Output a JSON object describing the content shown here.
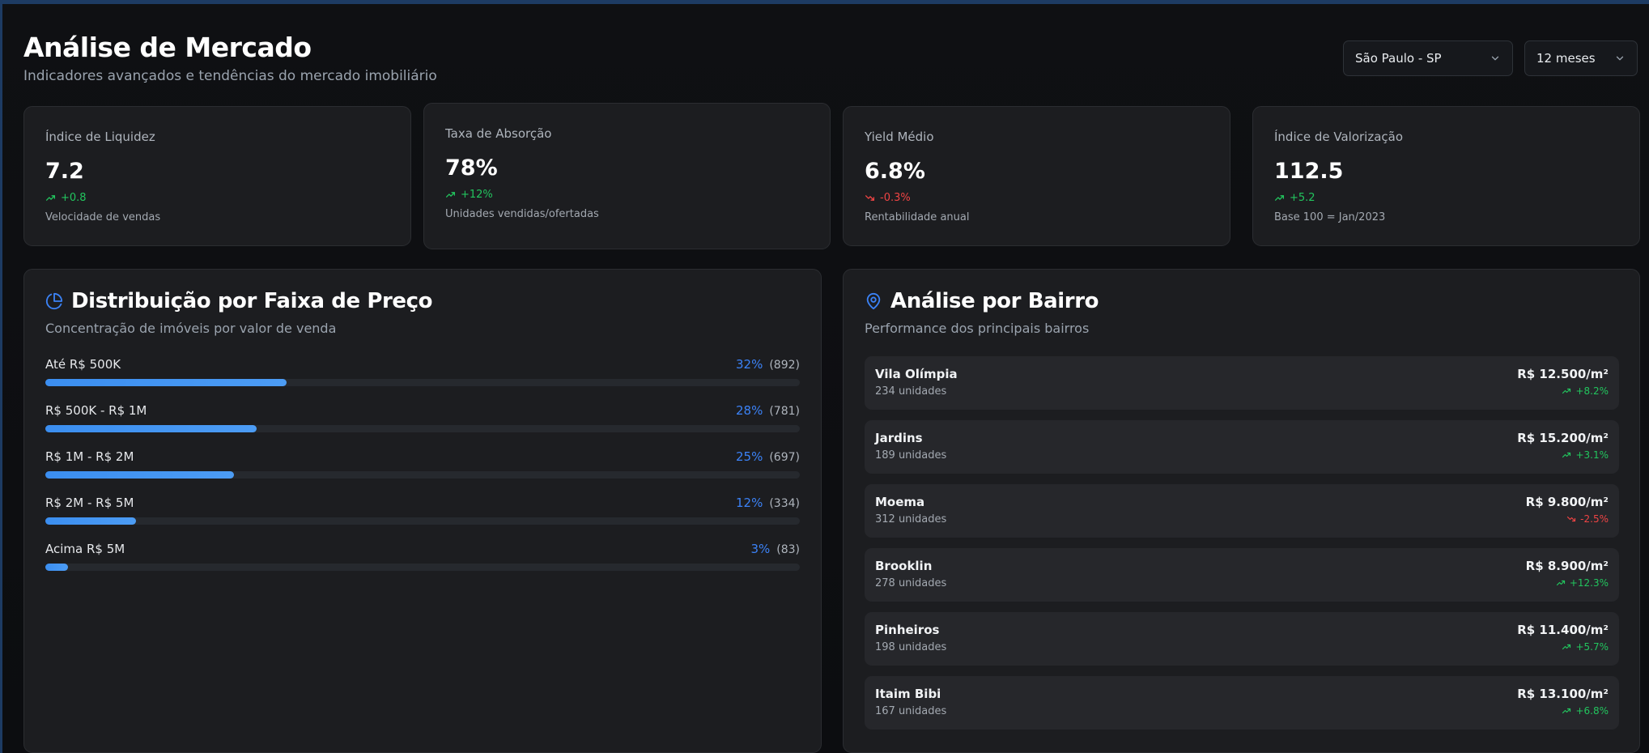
{
  "header": {
    "title": "Análise de Mercado",
    "subtitle": "Indicadores avançados e tendências do mercado imobiliário"
  },
  "controls": {
    "city": "São Paulo - SP",
    "period": "12 meses"
  },
  "kpis": [
    {
      "label": "Índice de Liquidez",
      "value": "7.2",
      "change": "+0.8",
      "trend": "up",
      "desc": "Velocidade de vendas"
    },
    {
      "label": "Taxa de Absorção",
      "value": "78%",
      "change": "+12%",
      "trend": "up",
      "desc": "Unidades vendidas/ofertadas"
    },
    {
      "label": "Yield Médio",
      "value": "6.8%",
      "change": "-0.3%",
      "trend": "down",
      "desc": "Rentabilidade anual"
    },
    {
      "label": "Índice de Valorização",
      "value": "112.5",
      "change": "+5.2",
      "trend": "up",
      "desc": "Base 100 = Jan/2023"
    }
  ],
  "distribution": {
    "title": "Distribuição por Faixa de Preço",
    "subtitle": "Concentração de imóveis por valor de venda",
    "ranges": [
      {
        "label": "Até R$ 500K",
        "pct": "32%",
        "count": "(892)",
        "share": 32
      },
      {
        "label": "R$ 500K - R$ 1M",
        "pct": "28%",
        "count": "(781)",
        "share": 28
      },
      {
        "label": "R$ 1M - R$ 2M",
        "pct": "25%",
        "count": "(697)",
        "share": 25
      },
      {
        "label": "R$ 2M - R$ 5M",
        "pct": "12%",
        "count": "(334)",
        "share": 12
      },
      {
        "label": "Acima R$ 5M",
        "pct": "3%",
        "count": "(83)",
        "share": 3
      }
    ]
  },
  "neighborhoods": {
    "title": "Análise por Bairro",
    "subtitle": "Performance dos principais bairros",
    "items": [
      {
        "name": "Vila Olímpia",
        "units": "234 unidades",
        "price": "R$ 12.500/m²",
        "change": "+8.2%",
        "trend": "up"
      },
      {
        "name": "Jardins",
        "units": "189 unidades",
        "price": "R$ 15.200/m²",
        "change": "+3.1%",
        "trend": "up"
      },
      {
        "name": "Moema",
        "units": "312 unidades",
        "price": "R$ 9.800/m²",
        "change": "-2.5%",
        "trend": "down"
      },
      {
        "name": "Brooklin",
        "units": "278 unidades",
        "price": "R$ 8.900/m²",
        "change": "+12.3%",
        "trend": "up"
      },
      {
        "name": "Pinheiros",
        "units": "198 unidades",
        "price": "R$ 11.400/m²",
        "change": "+5.7%",
        "trend": "up"
      },
      {
        "name": "Itaim Bibi",
        "units": "167 unidades",
        "price": "R$ 13.100/m²",
        "change": "+6.8%",
        "trend": "up"
      }
    ]
  },
  "colors": {
    "accent": "#3b82f6",
    "positive": "#22c55e",
    "negative": "#ef4444"
  },
  "icons": {
    "trend_up": "trending-up-icon",
    "trend_down": "trending-down-icon",
    "distribution": "pie-chart-icon",
    "neighborhoods": "map-pin-icon",
    "dropdown": "chevron-down-icon"
  }
}
